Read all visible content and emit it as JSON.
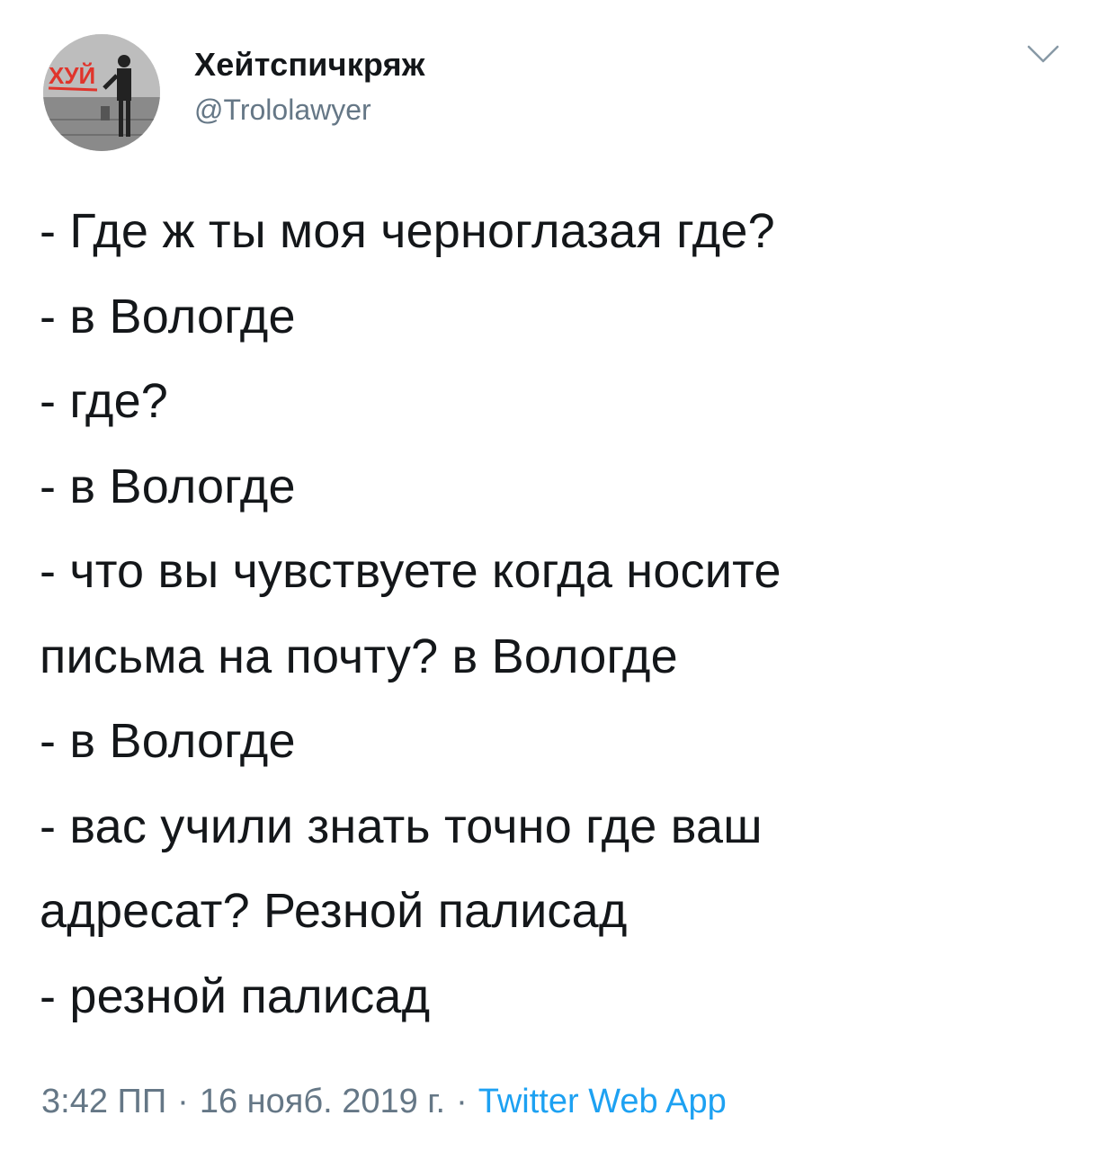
{
  "author": {
    "display_name": "Хейтспичкряж",
    "handle": "@Trololawyer",
    "avatar_graffiti_text": "ХУЙ"
  },
  "menu_icon": "chevron-down-icon",
  "tweet": {
    "text": "- Где ж ты моя черноглазая где?\n- в Вологде\n- где?\n- в Вологде\n- что вы чувствуете когда носите\nписьма на почту? в Вологде\n- в Вологде\n- вас учили знать точно где ваш\nадресат? Резной палисад\n- резной палисад"
  },
  "meta": {
    "time": "3:42 ПП",
    "separator": "·",
    "date": "16 нояб. 2019 г.",
    "source": "Twitter Web App"
  },
  "colors": {
    "text": "#14171a",
    "secondary": "#657786",
    "link": "#1da1f2"
  }
}
